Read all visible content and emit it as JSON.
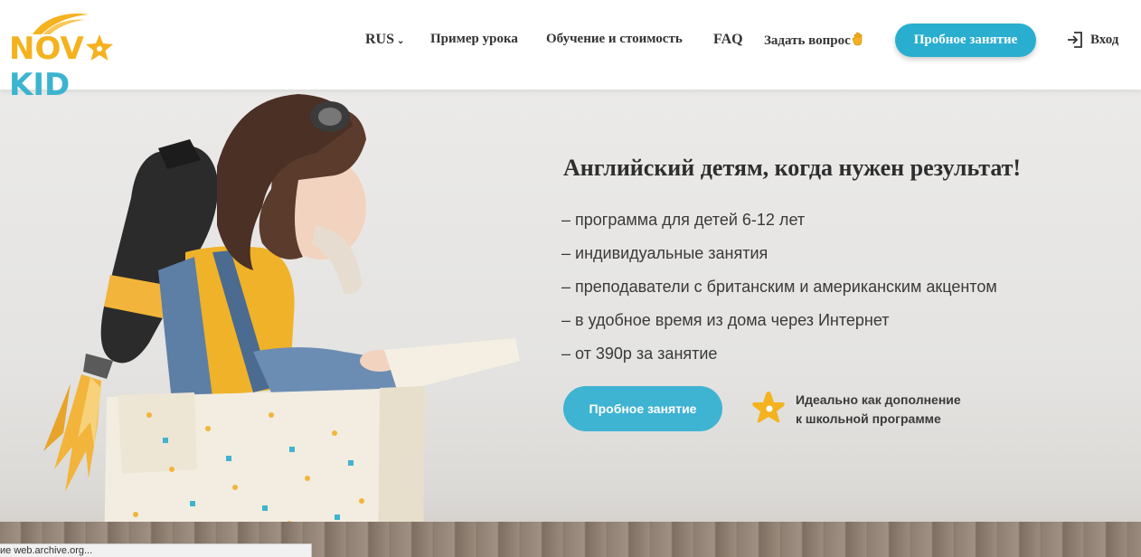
{
  "brand": {
    "logo_part1": "NOV",
    "logo_part2": "KID",
    "colors": {
      "yellow": "#f5b21f",
      "blue": "#3bb4cf"
    }
  },
  "nav": {
    "language": "RUS",
    "items": [
      "Пример урока",
      "Обучение и стоимость",
      "FAQ",
      "Задать вопрос"
    ],
    "trial_button": "Пробное занятие",
    "login": "Вход"
  },
  "hero": {
    "title": "Английский детям, когда нужен результат!",
    "features": [
      "– программа для детей 6-12 лет",
      "– индивидуальные занятия",
      "– преподаватели с британским и американским акцентом",
      "– в удобное время из дома через Интернет",
      "– от 390р за занятие"
    ],
    "trial_button": "Пробное занятие",
    "supplement_lines": [
      "Идеально как дополнение",
      "к школьной программе"
    ]
  },
  "status_bar": "ие web.archive.org..."
}
